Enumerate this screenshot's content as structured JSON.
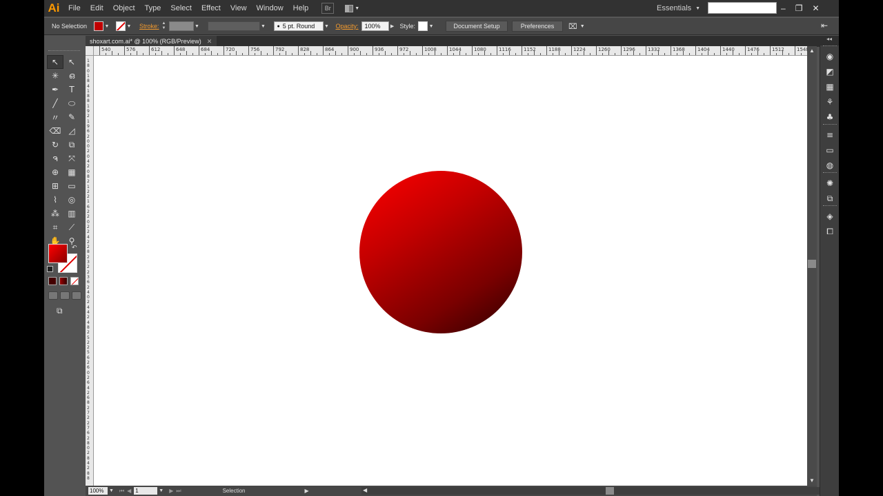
{
  "app": {
    "logo": "Ai",
    "menu": [
      "File",
      "Edit",
      "Object",
      "Type",
      "Select",
      "Effect",
      "View",
      "Window",
      "Help"
    ],
    "bridge_label": "Br",
    "workspace": "Essentials",
    "window_controls": [
      "–",
      "❐",
      "✕"
    ]
  },
  "control_bar": {
    "selection_label": "No Selection",
    "stroke_label": "Stroke:",
    "brush_label": "5 pt. Round",
    "opacity_label": "Opacity:",
    "opacity_value": "100%",
    "style_label": "Style:",
    "document_setup": "Document Setup",
    "preferences": "Preferences",
    "fill_color": "#c00000"
  },
  "document": {
    "tab_title": "shoxart.com.ai* @ 100% (RGB/Preview)",
    "tab_close": "✕"
  },
  "ruler": {
    "h_labels": [
      "540",
      "576",
      "612",
      "648",
      "684",
      "720",
      "756",
      "792",
      "828",
      "864",
      "900",
      "936",
      "972",
      "1008",
      "1044",
      "1080",
      "1116",
      "1152",
      "1188",
      "1224",
      "1260",
      "1296",
      "1332",
      "1368",
      "1404",
      "1440",
      "1476",
      "1512",
      "1548",
      "1584",
      "1620",
      "1656",
      "1692",
      "1728",
      "1764",
      "1800"
    ],
    "v_labels": [
      "1",
      "8",
      "0",
      "1",
      "8",
      "4",
      "1",
      "8",
      "8",
      "1",
      "9",
      "2",
      "1",
      "9",
      "6",
      "2",
      "0",
      "0",
      "2",
      "0",
      "4",
      "2",
      "0",
      "8",
      "2",
      "1",
      "2",
      "2",
      "1",
      "6",
      "2",
      "2",
      "0",
      "2",
      "2",
      "4",
      "2",
      "2",
      "8",
      "2",
      "3",
      "2",
      "2",
      "3",
      "6",
      "2",
      "4",
      "0",
      "2",
      "4",
      "4",
      "2",
      "4",
      "8",
      "2",
      "5",
      "2",
      "2",
      "5",
      "6",
      "2",
      "6",
      "0",
      "2",
      "6",
      "4",
      "2",
      "6",
      "8",
      "2",
      "7",
      "2",
      "2",
      "7",
      "6",
      "2",
      "8",
      "0",
      "2",
      "8",
      "4",
      "2",
      "8",
      "8"
    ]
  },
  "artwork": {
    "shape": "circle",
    "gradient_start": "#ff0000",
    "gradient_end": "#2a0000"
  },
  "tools": [
    {
      "name": "selection-tool",
      "glyph": "↖"
    },
    {
      "name": "direct-selection-tool",
      "glyph": "↖"
    },
    {
      "name": "magic-wand-tool",
      "glyph": "✳"
    },
    {
      "name": "lasso-tool",
      "glyph": "ഒ"
    },
    {
      "name": "pen-tool",
      "glyph": "✒"
    },
    {
      "name": "type-tool",
      "glyph": "T"
    },
    {
      "name": "line-tool",
      "glyph": "╱"
    },
    {
      "name": "ellipse-tool",
      "glyph": "⬭"
    },
    {
      "name": "paintbrush-tool",
      "glyph": "〃"
    },
    {
      "name": "pencil-tool",
      "glyph": "✎"
    },
    {
      "name": "blob-brush-tool",
      "glyph": "⌫"
    },
    {
      "name": "eraser-tool",
      "glyph": "◿"
    },
    {
      "name": "rotate-tool",
      "glyph": "↻"
    },
    {
      "name": "scale-tool",
      "glyph": "⧉"
    },
    {
      "name": "warp-tool",
      "glyph": "ຈ"
    },
    {
      "name": "free-transform-tool",
      "glyph": "⤧"
    },
    {
      "name": "shape-builder-tool",
      "glyph": "⊕"
    },
    {
      "name": "perspective-grid-tool",
      "glyph": "▦"
    },
    {
      "name": "mesh-tool",
      "glyph": "⊞"
    },
    {
      "name": "gradient-tool",
      "glyph": "▭"
    },
    {
      "name": "eyedropper-tool",
      "glyph": "⌇"
    },
    {
      "name": "blend-tool",
      "glyph": "◎"
    },
    {
      "name": "symbol-sprayer-tool",
      "glyph": "⁂"
    },
    {
      "name": "column-graph-tool",
      "glyph": "▥"
    },
    {
      "name": "artboard-tool",
      "glyph": "⌗"
    },
    {
      "name": "slice-tool",
      "glyph": "⟋"
    },
    {
      "name": "hand-tool",
      "glyph": "✋"
    },
    {
      "name": "zoom-tool",
      "glyph": "⚲"
    }
  ],
  "status": {
    "zoom": "100%",
    "page": "1",
    "tool_name": "Selection"
  },
  "dock_icons": [
    {
      "name": "color-guide-icon",
      "glyph": "◉"
    },
    {
      "name": "appearance-icon",
      "glyph": "◩"
    },
    {
      "name": "swatches-icon",
      "glyph": "▦"
    },
    {
      "name": "brushes-icon",
      "glyph": "⚘"
    },
    {
      "name": "symbols-icon",
      "glyph": "♣"
    },
    {
      "name": "stroke-panel-icon",
      "glyph": "≡"
    },
    {
      "name": "gradient-panel-icon",
      "glyph": "▭"
    },
    {
      "name": "transparency-icon",
      "glyph": "◍"
    },
    {
      "name": "graphic-styles-icon",
      "glyph": "✺"
    },
    {
      "name": "image-trace-icon",
      "glyph": "⧉"
    },
    {
      "name": "layers-icon",
      "glyph": "◈"
    },
    {
      "name": "artboards-icon",
      "glyph": "⧠"
    }
  ]
}
